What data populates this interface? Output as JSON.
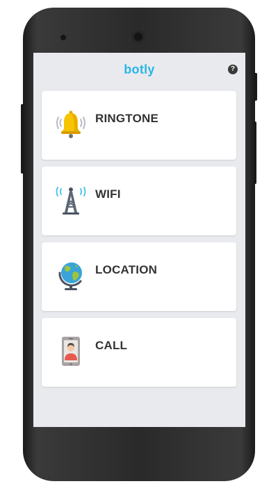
{
  "app": {
    "title": "botly",
    "help_symbol": "?"
  },
  "menu": {
    "items": [
      {
        "label": "RINGTONE",
        "icon": "bell-icon"
      },
      {
        "label": "WIFI",
        "icon": "wifi-tower-icon"
      },
      {
        "label": "LOCATION",
        "icon": "globe-icon"
      },
      {
        "label": "CALL",
        "icon": "phone-contact-icon"
      }
    ]
  },
  "colors": {
    "accent": "#29b5e8",
    "screen_background": "#e8eaed",
    "card_background": "#ffffff",
    "label_text": "#333333"
  }
}
